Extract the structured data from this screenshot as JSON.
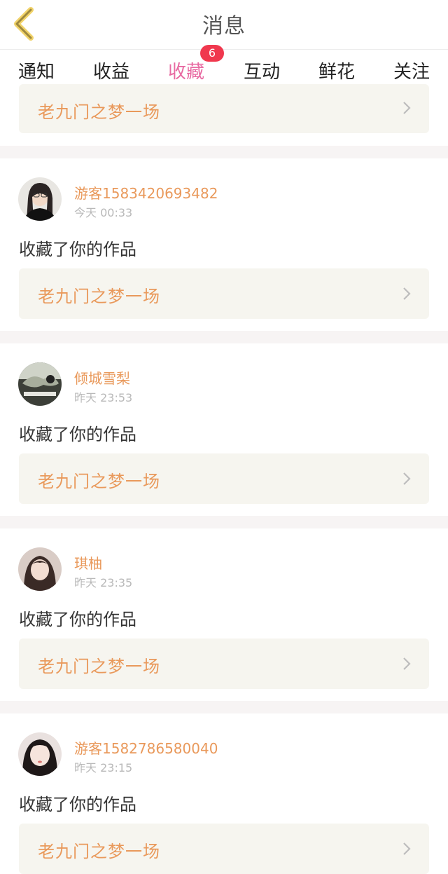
{
  "header": {
    "title": "消息"
  },
  "tabs": [
    {
      "label": "通知"
    },
    {
      "label": "收益"
    },
    {
      "label": "收藏",
      "badge": "6",
      "active": true
    },
    {
      "label": "互动"
    },
    {
      "label": "鲜花"
    },
    {
      "label": "关注"
    }
  ],
  "items": [
    {
      "work_title": "老九门之梦一场"
    },
    {
      "user": "游客1583420693482",
      "time": "今天 00:33",
      "action": "收藏了你的作品",
      "work_title": "老九门之梦一场"
    },
    {
      "user": "倾城雪梨",
      "time": "昨天 23:53",
      "action": "收藏了你的作品",
      "work_title": "老九门之梦一场"
    },
    {
      "user": "琪柚",
      "time": "昨天 23:35",
      "action": "收藏了你的作品",
      "work_title": "老九门之梦一场"
    },
    {
      "user": "游客1582786580040",
      "time": "昨天 23:15",
      "action": "收藏了你的作品",
      "work_title": "老九门之梦一场"
    }
  ],
  "colors": {
    "accent_pink": "#e86aa2",
    "badge_red": "#f0384e",
    "name_orange": "#e9995b",
    "back_yellow": "#f1d36a"
  }
}
